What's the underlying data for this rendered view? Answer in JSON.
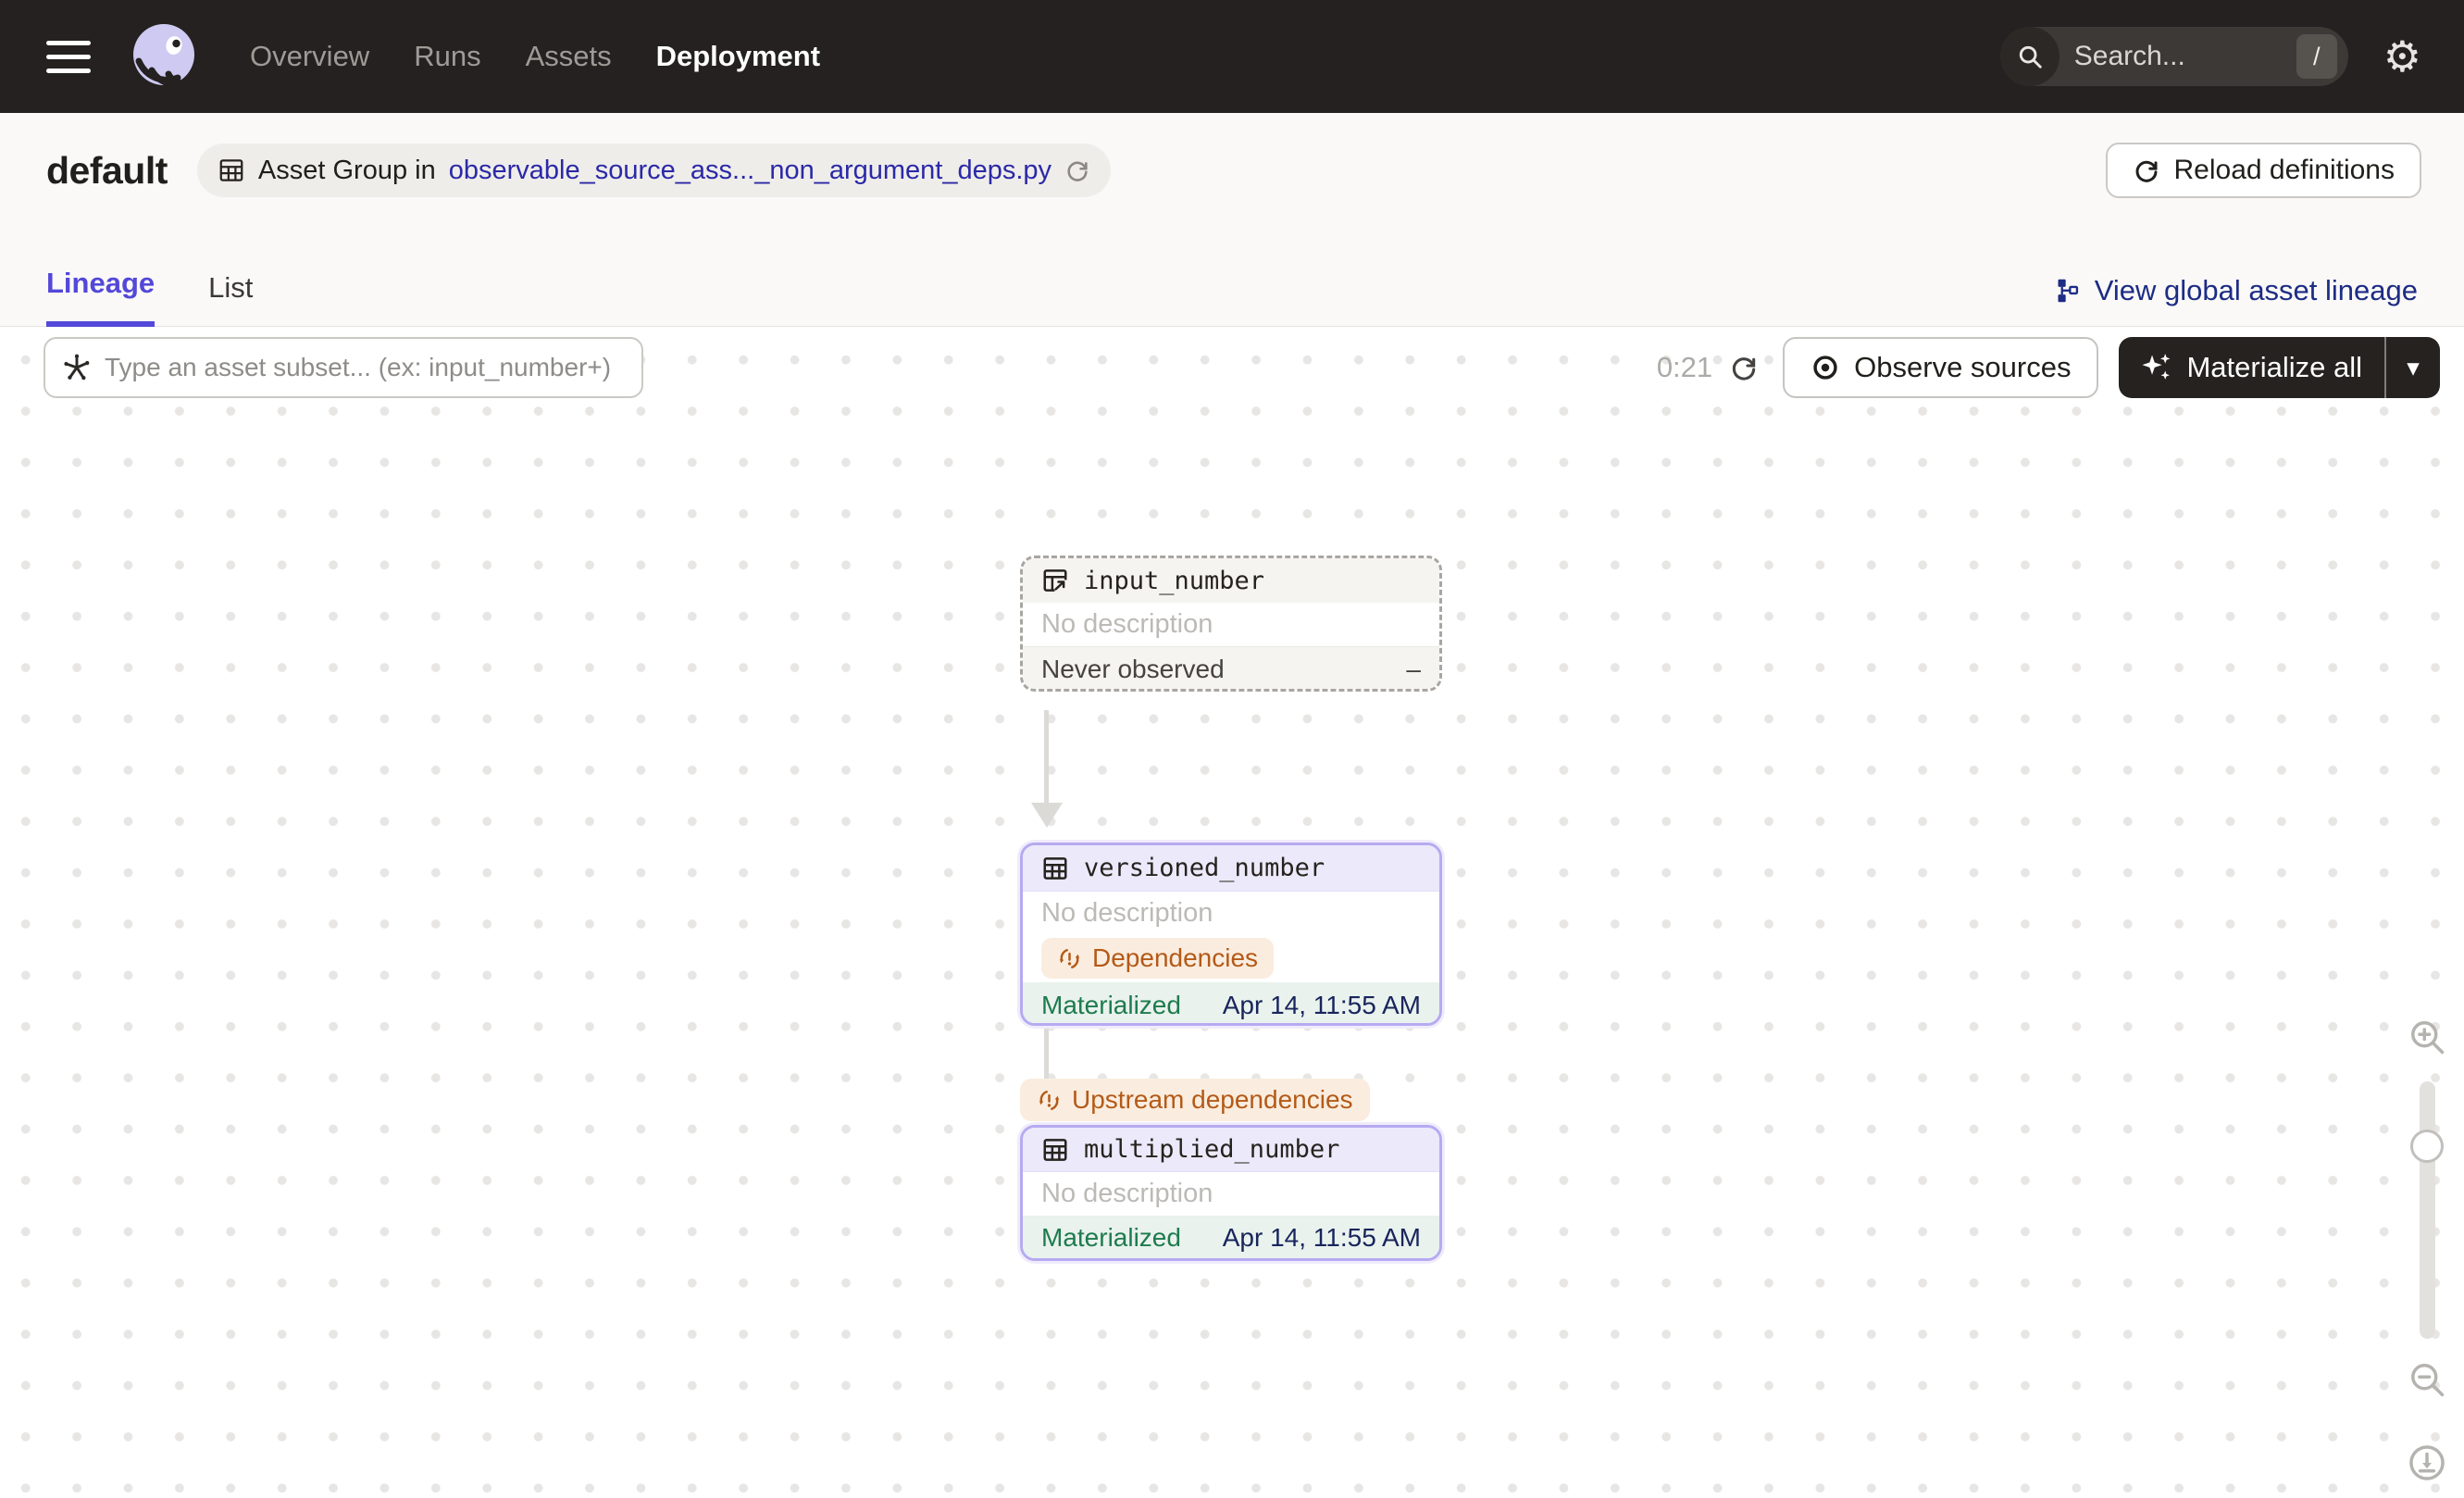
{
  "colors": {
    "accent_indigo": "#5348D8",
    "node_border_purple": "#B6AAF1",
    "badge_orange": "#B45A18",
    "materialized_green": "#1E7B4E",
    "link_navy": "#1D2C85",
    "breadcrumb_link_blue": "#2B29A6",
    "topnav_bg": "#242120"
  },
  "nav": {
    "menu_items": [
      {
        "label": "Overview"
      },
      {
        "label": "Runs"
      },
      {
        "label": "Assets"
      },
      {
        "label": "Deployment",
        "active": true
      }
    ],
    "search_placeholder": "Search...",
    "search_shortcut": "/"
  },
  "header": {
    "title": "default",
    "group_label": "Asset Group in",
    "group_file": "observable_source_ass..._non_argument_deps.py",
    "reload_button": "Reload definitions"
  },
  "tabs": {
    "lineage": "Lineage",
    "list": "List",
    "global_lineage": "View global asset lineage"
  },
  "toolbar": {
    "filter_placeholder": "Type an asset subset... (ex: input_number+)",
    "timer": "0:21",
    "observe_button": "Observe sources",
    "materialize_button": "Materialize all"
  },
  "graph": {
    "edge_badge": "Upstream dependencies",
    "nodes": [
      {
        "name": "input_number",
        "description": "No description",
        "status": "Never observed",
        "status_value": "–"
      },
      {
        "name": "versioned_number",
        "description": "No description",
        "badge": "Dependencies",
        "status": "Materialized",
        "timestamp": "Apr 14, 11:55 AM"
      },
      {
        "name": "multiplied_number",
        "description": "No description",
        "status": "Materialized",
        "timestamp": "Apr 14, 11:55 AM"
      }
    ]
  }
}
